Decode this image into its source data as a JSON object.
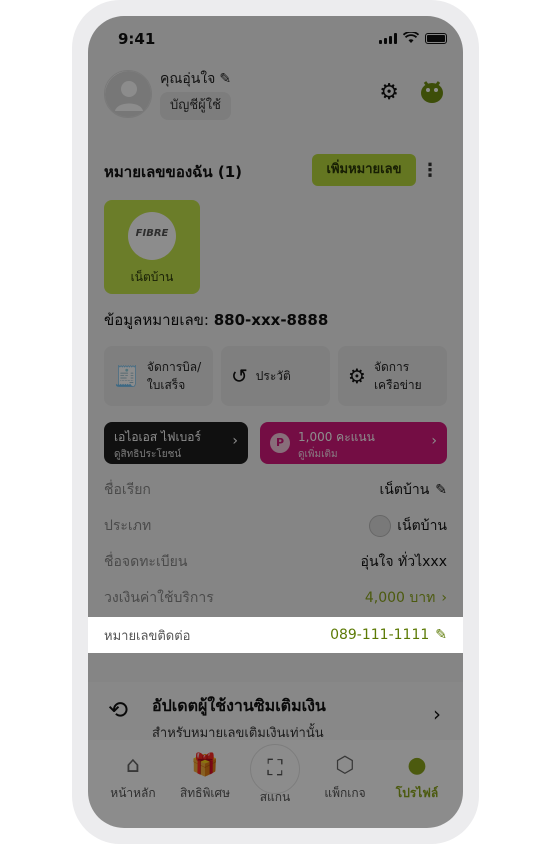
{
  "status": {
    "time": "9:41"
  },
  "user": {
    "name": "คุณอุ่นใจ",
    "account_button": "บัญชีผู้ใช้"
  },
  "numbers_section": {
    "title": "หมายเลขของฉัน (1)",
    "add_button": "เพิ่มหมายเลข"
  },
  "number_card": {
    "logo_text": "FIBRE",
    "label": "เน็ตบ้าน"
  },
  "info": {
    "label": "ข้อมูลหมายเลข:",
    "value": "880-xxx-8888"
  },
  "actions": [
    {
      "label_line1": "จัดการบิล/",
      "label_line2": "ใบเสร็จ",
      "icon": "bill-icon"
    },
    {
      "label_line1": "ประวัติ",
      "label_line2": "",
      "icon": "history-icon"
    },
    {
      "label_line1": "จัดการ",
      "label_line2": "เครือข่าย",
      "icon": "network-settings-icon"
    }
  ],
  "promos": {
    "fiber": {
      "title": "เอไอเอส ไฟเบอร์",
      "sub": "ดูสิทธิประโยชน์"
    },
    "points": {
      "badge": "P",
      "title": "1,000 คะแนน",
      "sub": "ดูเพิ่มเติม"
    }
  },
  "rows": {
    "nickname": {
      "label": "ชื่อเรียก",
      "value": "เน็ตบ้าน"
    },
    "type": {
      "label": "ประเภท",
      "value": "เน็ตบ้าน"
    },
    "registered": {
      "label": "ชื่อจดทะเบียน",
      "value": "อุ่นใจ ทั่วไxxx"
    },
    "limit": {
      "label": "วงเงินค่าใช้บริการ",
      "value": "4,000 บาท"
    },
    "contact": {
      "label": "หมายเลขติดต่อ",
      "value": "089-111-1111"
    }
  },
  "update_card": {
    "title": "อัปเดตผู้ใช้งานซิมเติมเงิน",
    "subtitle": "สำหรับหมายเลขเติมเงินเท่านั้น"
  },
  "tabs": [
    {
      "label": "หน้าหลัก",
      "icon": "home-icon"
    },
    {
      "label": "สิทธิพิเศษ",
      "icon": "gift-icon"
    },
    {
      "label": "สแกน",
      "icon": "scan-icon"
    },
    {
      "label": "แพ็กเกจ",
      "icon": "package-icon"
    },
    {
      "label": "โปรไฟล์",
      "icon": "profile-icon"
    }
  ],
  "colors": {
    "accent": "#b6d83c",
    "points": "#d4187c",
    "contact_value": "#5c7a05"
  }
}
